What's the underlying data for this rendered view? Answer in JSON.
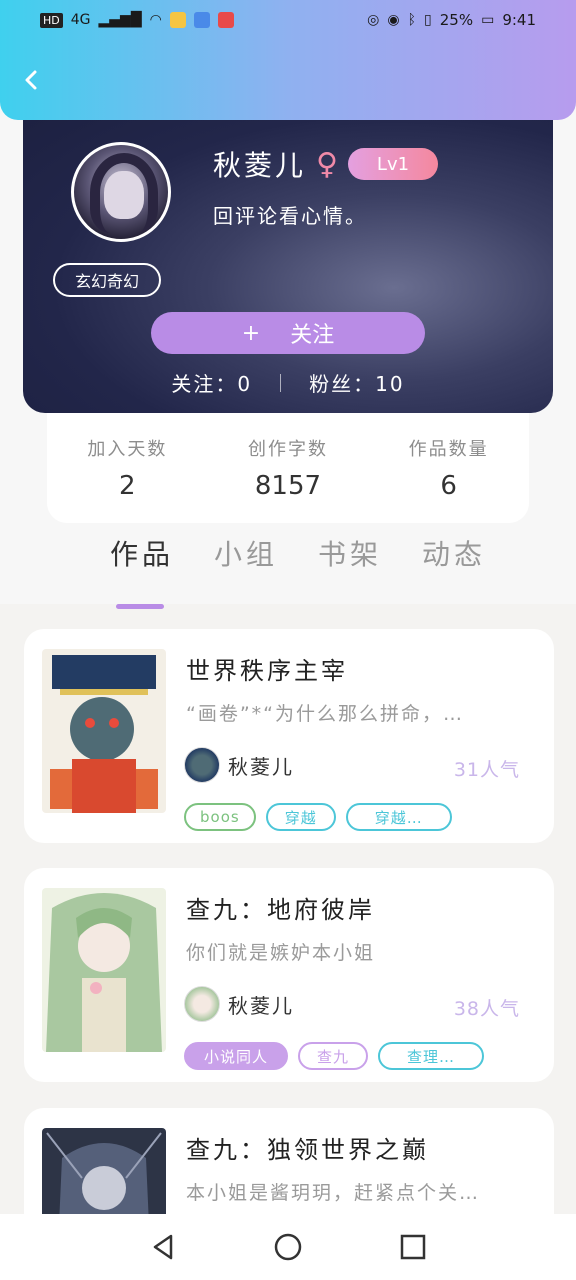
{
  "status_bar": {
    "left": [
      "HD",
      "4G"
    ],
    "battery": "25%",
    "time": "9:41"
  },
  "header": {
    "back_icon": "chevron-left-icon",
    "gradient": [
      "#3fd0ee",
      "#b79cee"
    ]
  },
  "profile": {
    "name": "秋菱儿",
    "gender_symbol": "♀",
    "level": "Lv1",
    "bio": "回评论看心情。",
    "genre_tag": "玄幻奇幻",
    "follow_button": {
      "icon": "+",
      "label": "关注"
    },
    "following_label": "关注：0",
    "fans_label": "粉丝：10"
  },
  "stats": [
    {
      "label": "加入天数",
      "value": "2"
    },
    {
      "label": "创作字数",
      "value": "8157"
    },
    {
      "label": "作品数量",
      "value": "6"
    }
  ],
  "tabs": [
    {
      "label": "作品",
      "active": true
    },
    {
      "label": "小组",
      "active": false
    },
    {
      "label": "书架",
      "active": false
    },
    {
      "label": "动态",
      "active": false
    }
  ],
  "works": [
    {
      "title": "世界秩序主宰",
      "desc": "“画卷”*“为什么那么拼命，…",
      "author": "秋菱儿",
      "popularity": "31人气",
      "tags": [
        {
          "label": "boos",
          "color": "#7cc27f",
          "filled": false
        },
        {
          "label": "穿越",
          "color": "#4cc6d8",
          "filled": false
        },
        {
          "label": "穿越…",
          "color": "#4cc6d8",
          "filled": false
        }
      ]
    },
    {
      "title": "查九：地府彼岸",
      "desc": "你们就是嫉妒本小姐",
      "author": "秋菱儿",
      "popularity": "38人气",
      "tags": [
        {
          "label": "小说同人",
          "color": "#c9a1ea",
          "filled": true
        },
        {
          "label": "查九",
          "color": "#c9a1ea",
          "filled": false
        },
        {
          "label": "查理…",
          "color": "#4cc6d8",
          "filled": false
        }
      ]
    },
    {
      "title": "查九：独领世界之巅",
      "desc": "本小姐是酱玥玥，赶紧点个关…",
      "author": "",
      "popularity": "",
      "tags": []
    }
  ],
  "nav": [
    "back-triangle-icon",
    "home-circle-icon",
    "recents-square-icon"
  ]
}
